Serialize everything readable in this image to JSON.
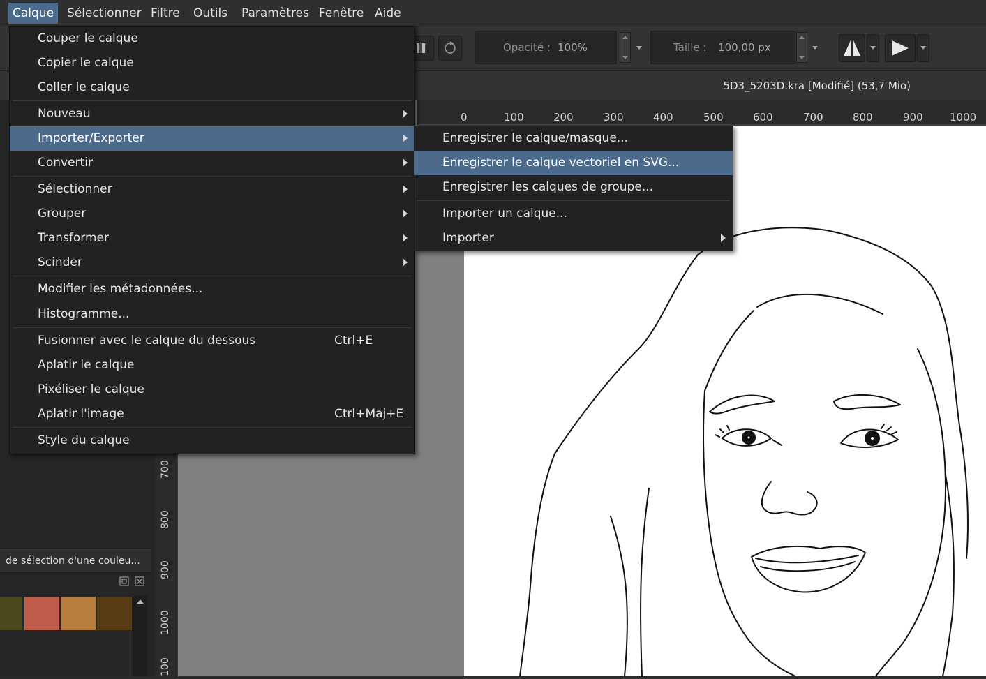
{
  "menubar": {
    "items": [
      "Calque",
      "Sélectionner",
      "Filtre",
      "Outils",
      "Paramètres",
      "Fenêtre",
      "Aide"
    ],
    "active": "Calque"
  },
  "toolbar": {
    "opacity_label": "Opacité :",
    "opacity_value": "100%",
    "size_label": "Taille :",
    "size_value": "100,00 px"
  },
  "document": {
    "title": "5D3_5203D.kra [Modifié]  (53,7 Mio)"
  },
  "ruler": {
    "horizontal_ticks": [
      "0",
      "100",
      "200",
      "300",
      "400",
      "500",
      "600",
      "700",
      "800",
      "900",
      "1000"
    ],
    "vertical_ticks": [
      "700",
      "800",
      "900",
      "1000",
      "100"
    ]
  },
  "layer_menu": {
    "items": [
      {
        "label": "Couper le calque",
        "shortcut": "",
        "submenu": false
      },
      {
        "label": "Copier le calque",
        "shortcut": "",
        "submenu": false
      },
      {
        "label": "Coller le calque",
        "shortcut": "",
        "submenu": false
      },
      {
        "label": "Nouveau",
        "shortcut": "",
        "submenu": true
      },
      {
        "label": "Importer/Exporter",
        "shortcut": "",
        "submenu": true
      },
      {
        "label": "Convertir",
        "shortcut": "",
        "submenu": true
      },
      {
        "label": "Sélectionner",
        "shortcut": "",
        "submenu": true
      },
      {
        "label": "Grouper",
        "shortcut": "",
        "submenu": true
      },
      {
        "label": "Transformer",
        "shortcut": "",
        "submenu": true
      },
      {
        "label": "Scinder",
        "shortcut": "",
        "submenu": true
      },
      {
        "label": "Modifier les métadonnées...",
        "shortcut": "",
        "submenu": false
      },
      {
        "label": "Histogramme...",
        "shortcut": "",
        "submenu": false
      },
      {
        "label": "Fusionner avec le calque du dessous",
        "shortcut": "Ctrl+E",
        "submenu": false
      },
      {
        "label": "Aplatir le calque",
        "shortcut": "",
        "submenu": false
      },
      {
        "label": "Pixéliser le calque",
        "shortcut": "",
        "submenu": false
      },
      {
        "label": "Aplatir l'image",
        "shortcut": "Ctrl+Maj+E",
        "submenu": false
      },
      {
        "label": "Style du calque",
        "shortcut": "",
        "submenu": false
      }
    ],
    "highlighted": "Importer/Exporter"
  },
  "import_export_submenu": {
    "items": [
      {
        "label": "Enregistrer le calque/masque...",
        "submenu": false
      },
      {
        "label": "Enregistrer le calque vectoriel en SVG...",
        "submenu": false
      },
      {
        "label": "Enregistrer les calques de groupe...",
        "submenu": false
      },
      {
        "label": "Importer un calque...",
        "submenu": false
      },
      {
        "label": "Importer",
        "submenu": true
      }
    ],
    "highlighted": "Enregistrer le calque vectoriel en SVG..."
  },
  "color_panel": {
    "title": "de sélection d'une couleu...",
    "swatches": [
      "#4a4a1c",
      "#c25c4a",
      "#b87c3c",
      "#5a3c14"
    ]
  },
  "colors": {
    "accent": "#4b6a8c",
    "menu_bg": "#222222",
    "canvas_bg": "#808080"
  }
}
